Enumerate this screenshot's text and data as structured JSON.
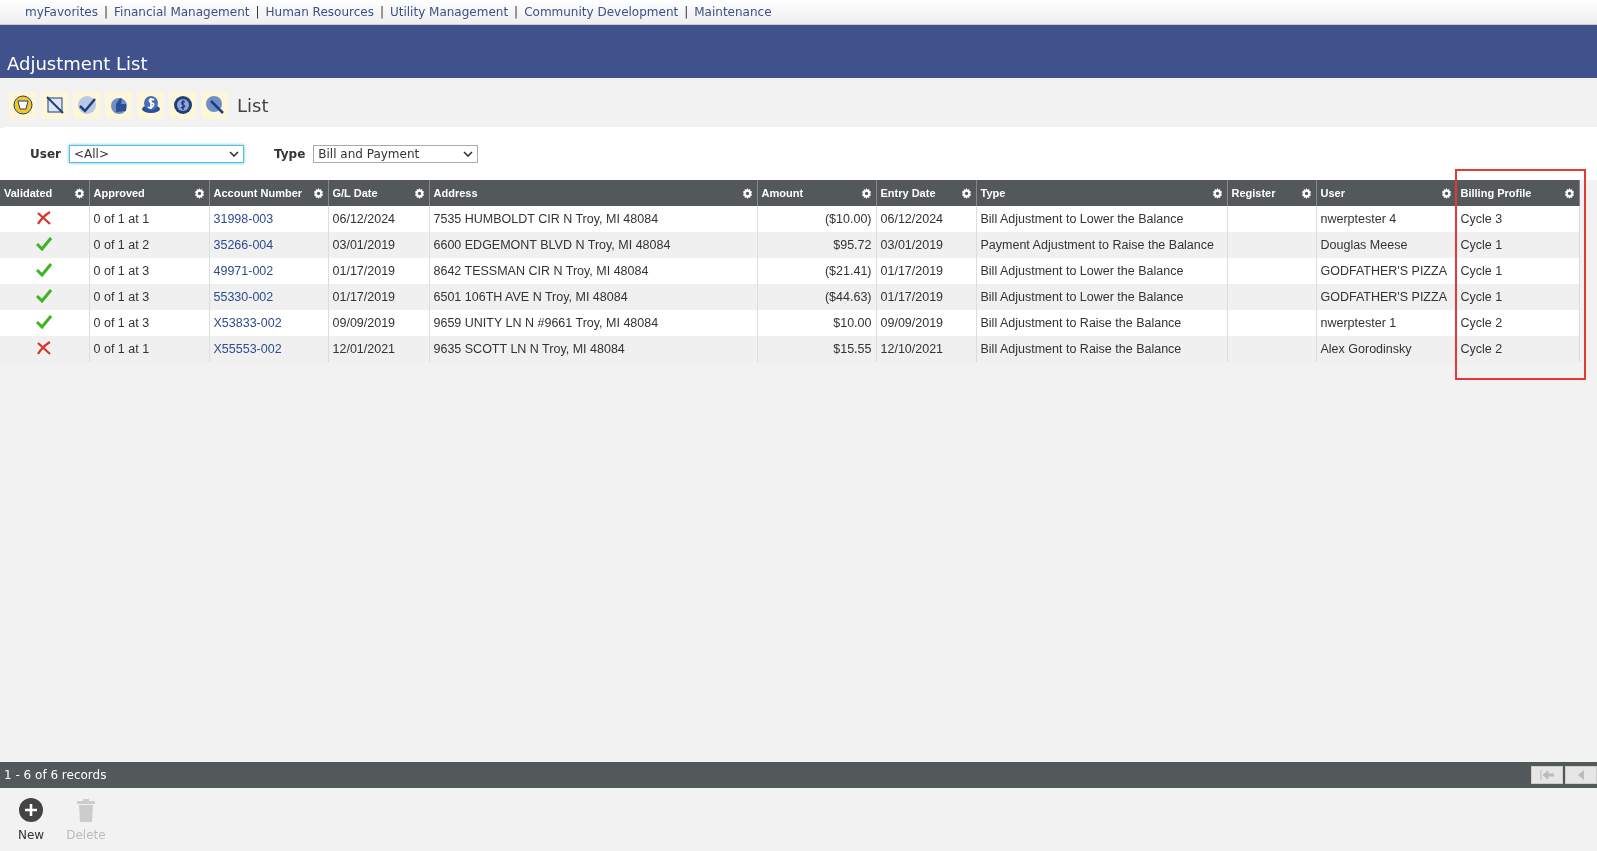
{
  "nav_links": [
    "myFavorites",
    "Financial Management",
    "Human Resources",
    "Utility Management",
    "Community Development",
    "Maintenance"
  ],
  "nav_separator": "|",
  "page_title": "Adjustment List",
  "toolbar": {
    "label": "List"
  },
  "filters": [
    {
      "label": "User",
      "value": "<All>",
      "focused": true
    },
    {
      "label": "Type",
      "value": "Bill and Payment",
      "focused": false
    }
  ],
  "table": {
    "columns": [
      {
        "label": "Validated",
        "highlighted": false
      },
      {
        "label": "Approved",
        "highlighted": false
      },
      {
        "label": "Account Number",
        "highlighted": false
      },
      {
        "label": "G/L Date",
        "highlighted": false
      },
      {
        "label": "Address",
        "highlighted": false
      },
      {
        "label": "Amount",
        "highlighted": false
      },
      {
        "label": "Entry Date",
        "highlighted": false
      },
      {
        "label": "Type",
        "highlighted": false
      },
      {
        "label": "Register",
        "highlighted": false
      },
      {
        "label": "User",
        "highlighted": false
      },
      {
        "label": "Billing Profile",
        "highlighted": true
      }
    ],
    "rows": [
      {
        "validated": false,
        "approved": "0 of 1 at 1",
        "account": "31998-003",
        "gl_date": "06/12/2024",
        "address": "7535 HUMBOLDT CIR N Troy, MI 48084",
        "amount": "($10.00)",
        "entry_date": "06/12/2024",
        "type": "Bill Adjustment to Lower the Balance",
        "user": "nwerptester 4",
        "billing_profile": "Cycle 3"
      },
      {
        "validated": true,
        "approved": "0 of 1 at 2",
        "account": "35266-004",
        "gl_date": "03/01/2019",
        "address": "6600 EDGEMONT BLVD N Troy, MI 48084",
        "amount": "$95.72",
        "entry_date": "03/01/2019",
        "type": "Payment Adjustment to Raise the Balance",
        "user": "Douglas Meese",
        "billing_profile": "Cycle 1"
      },
      {
        "validated": true,
        "approved": "0 of 1 at 3",
        "account": "49971-002",
        "gl_date": "01/17/2019",
        "address": "8642 TESSMAN CIR N Troy, MI 48084",
        "amount": "($21.41)",
        "entry_date": "01/17/2019",
        "type": "Bill Adjustment to Lower the Balance",
        "user": "GODFATHER'S PIZZA",
        "billing_profile": "Cycle 1"
      },
      {
        "validated": true,
        "approved": "0 of 1 at 3",
        "account": "55330-002",
        "gl_date": "01/17/2019",
        "address": "6501 106TH AVE N Troy, MI 48084",
        "amount": "($44.63)",
        "entry_date": "01/17/2019",
        "type": "Bill Adjustment to Lower the Balance",
        "user": "GODFATHER'S PIZZA",
        "billing_profile": "Cycle 1"
      },
      {
        "validated": true,
        "approved": "0 of 1 at 3",
        "account": "X53833-002",
        "gl_date": "09/09/2019",
        "address": "9659 UNITY LN N #9661 Troy, MI 48084",
        "amount": "$10.00",
        "entry_date": "09/09/2019",
        "type": "Bill Adjustment to Raise the Balance",
        "user": "nwerptester 1",
        "billing_profile": "Cycle 2"
      },
      {
        "validated": false,
        "approved": "0 of 1 at 1",
        "account": "X55553-002",
        "gl_date": "12/01/2021",
        "address": "9635 SCOTT LN N Troy, MI 48084",
        "amount": "$15.55",
        "entry_date": "12/10/2021",
        "type": "Bill Adjustment to Raise the Balance",
        "user": "Alex Gorodinsky",
        "billing_profile": "Cycle 2"
      }
    ]
  },
  "status_bar": {
    "text": "1 - 6 of 6 records",
    "pager": [
      {
        "kind": "first",
        "disabled": true
      },
      {
        "kind": "previous",
        "disabled": true
      }
    ]
  },
  "actions": [
    {
      "kind": "new",
      "label": "New",
      "disabled": false
    },
    {
      "kind": "delete",
      "label": "Delete",
      "disabled": true
    }
  ]
}
